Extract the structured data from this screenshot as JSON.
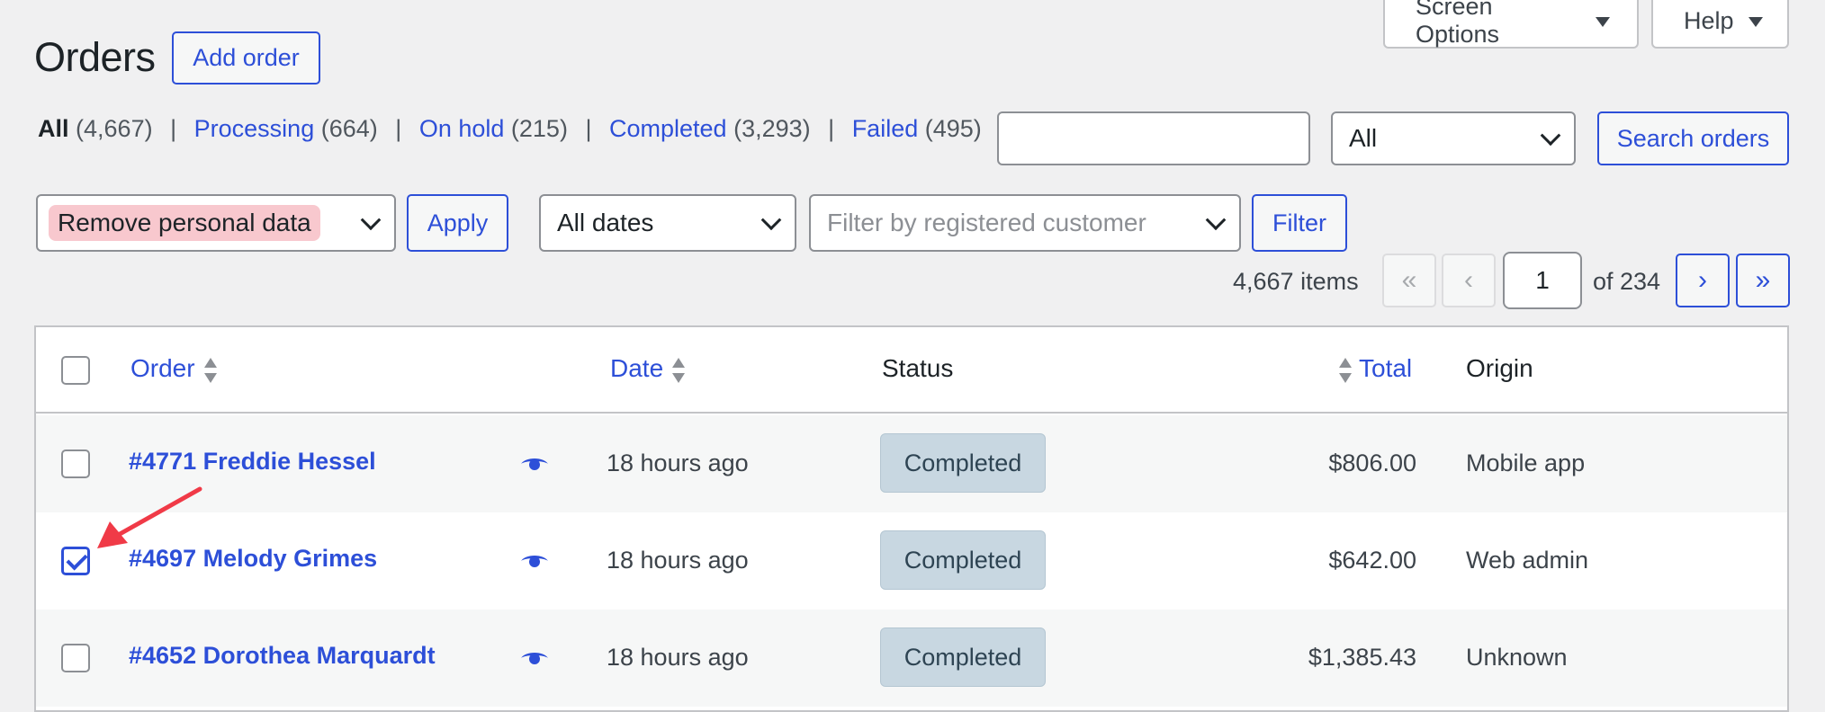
{
  "header": {
    "title": "Orders",
    "add_order_label": "Add order",
    "screen_options_label": "Screen Options",
    "help_label": "Help"
  },
  "views": [
    {
      "label": "All",
      "count": "(4,667)",
      "current": true
    },
    {
      "label": "Processing",
      "count": "(664)"
    },
    {
      "label": "On hold",
      "count": "(215)"
    },
    {
      "label": "Completed",
      "count": "(3,293)"
    },
    {
      "label": "Failed",
      "count": "(495)"
    }
  ],
  "search": {
    "value": "",
    "status_filter": "All",
    "button_label": "Search orders"
  },
  "filters": {
    "bulk_action": "Remove personal data",
    "apply_label": "Apply",
    "dates": "All dates",
    "customer_placeholder": "Filter by registered customer",
    "filter_label": "Filter"
  },
  "pagination": {
    "items": "4,667 items",
    "first": "«",
    "prev": "‹",
    "current_page": "1",
    "of": "of 234",
    "next": "›",
    "last": "»"
  },
  "table": {
    "columns": {
      "order": "Order",
      "date": "Date",
      "status": "Status",
      "total": "Total",
      "origin": "Origin"
    },
    "rows": [
      {
        "order": "#4771 Freddie Hessel",
        "date": "18 hours ago",
        "status": "Completed",
        "total": "$806.00",
        "origin": "Mobile app",
        "checked": false
      },
      {
        "order": "#4697 Melody Grimes",
        "date": "18 hours ago",
        "status": "Completed",
        "total": "$642.00",
        "origin": "Web admin",
        "checked": true
      },
      {
        "order": "#4652 Dorothea Marquardt",
        "date": "18 hours ago",
        "status": "Completed",
        "total": "$1,385.43",
        "origin": "Unknown",
        "checked": false
      }
    ]
  },
  "colors": {
    "link": "#2d4fd8",
    "badge_bg": "#c8d7e1",
    "annotation_arrow": "#f03a47",
    "highlight": "#f8c8ce"
  }
}
